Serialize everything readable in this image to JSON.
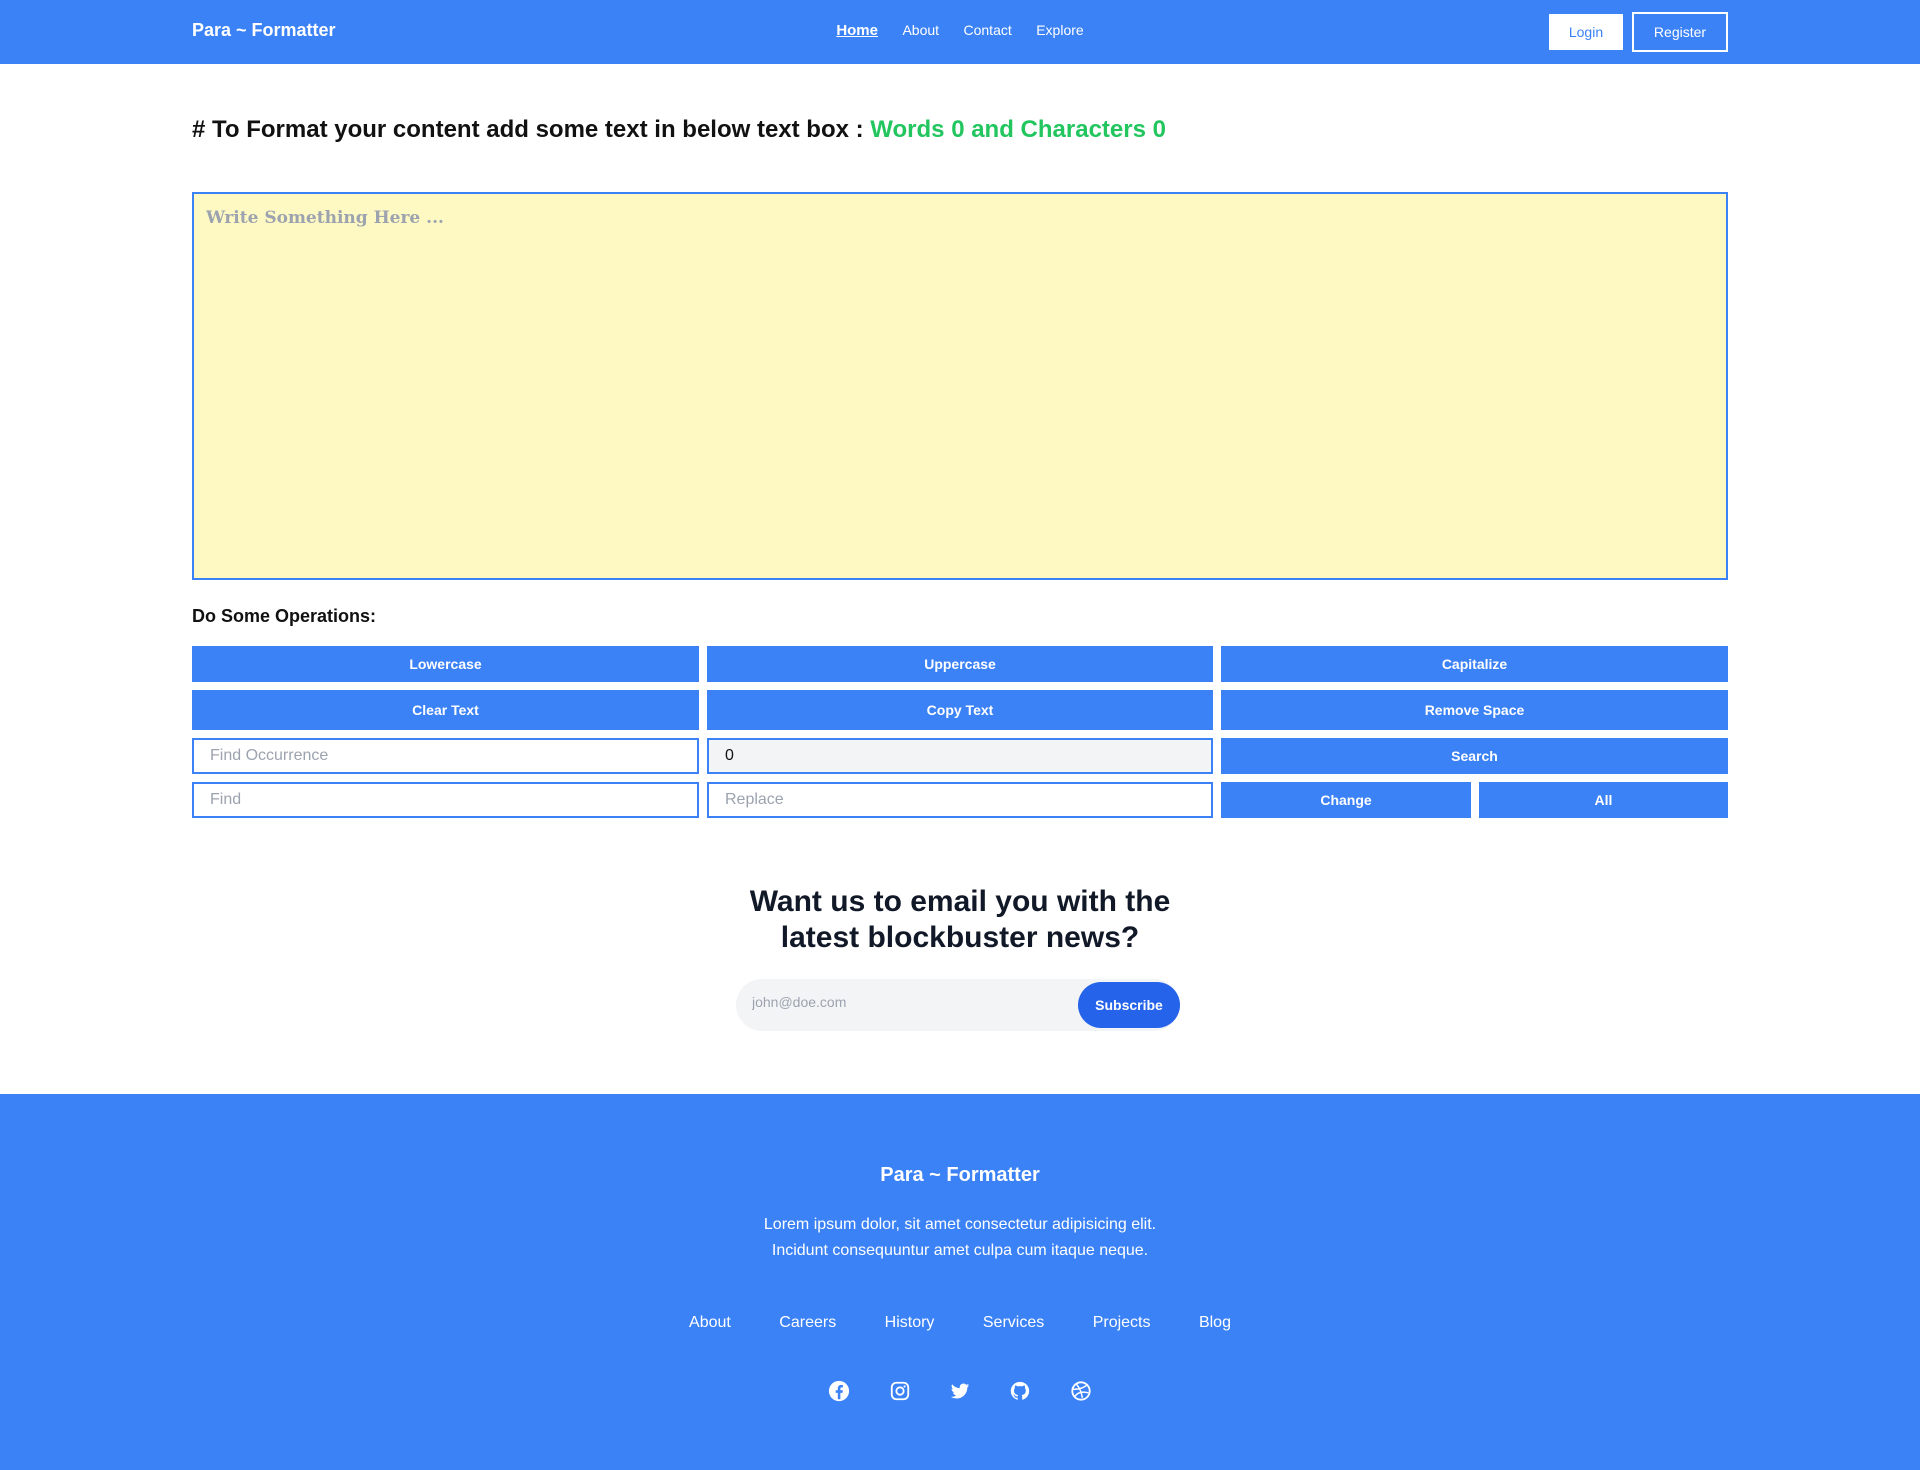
{
  "nav": {
    "brand": "Para ~ Formatter",
    "links": [
      "Home",
      "About",
      "Contact",
      "Explore"
    ],
    "login": "Login",
    "register": "Register"
  },
  "heading": {
    "text": "# To Format your content add some text in below text box : ",
    "counts": "Words 0 and Characters 0"
  },
  "editor": {
    "placeholder": "Write Something Here ...",
    "value": ""
  },
  "operations": {
    "title": "Do Some Operations:",
    "lowercase": "Lowercase",
    "uppercase": "Uppercase",
    "capitalize": "Capitalize",
    "clear": "Clear Text",
    "copy": "Copy Text",
    "remove_space": "Remove Space",
    "find_occurrence_placeholder": "Find Occurrence",
    "occurrence_count": "0",
    "search": "Search",
    "find_placeholder": "Find",
    "replace_placeholder": "Replace",
    "change": "Change",
    "all": "All"
  },
  "newsletter": {
    "title_line1": "Want us to email you with the",
    "title_line2": "latest blockbuster news?",
    "email_placeholder": "john@doe.com",
    "subscribe": "Subscribe"
  },
  "footer": {
    "brand": "Para ~ Formatter",
    "desc_line1": "Lorem ipsum dolor, sit amet consectetur adipisicing elit.",
    "desc_line2": "Incidunt consequuntur amet culpa cum itaque neque.",
    "links": [
      "About",
      "Careers",
      "History",
      "Services",
      "Projects",
      "Blog"
    ],
    "social": [
      "facebook-icon",
      "instagram-icon",
      "twitter-icon",
      "github-icon",
      "dribbble-icon"
    ]
  }
}
